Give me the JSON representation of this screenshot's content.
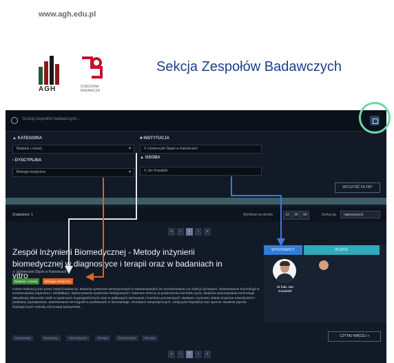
{
  "slide": {
    "url": "www.agh.edu.pl",
    "logo_text": "AGH",
    "dept_text": "DZIEDZINA BADAWCZA",
    "title": "Sekcja Zespołów Badawczych"
  },
  "app": {
    "search_placeholder": "Szukaj zespołów badawczych...",
    "filters": {
      "kategoria_label": "KATEGORIA",
      "kategoria_value": "Badania i rozwój",
      "dyscyplina_label": "DYSCYPLINA",
      "dyscyplina_value": "Biologia medyczna",
      "instytucja_label": "INSTYTUCJA",
      "instytucja_value": "Uniwersytet Śląski w Katowicach",
      "osoba_label": "OSOBA",
      "osoba_value": "Jan Kowalski",
      "clear_label": "WYCZYŚĆ FILTRY"
    },
    "results": {
      "count_label": "Znaleziono: 1",
      "per_page_label": "Wyników na stronie",
      "per_page_options": [
        "10",
        "20",
        "50"
      ],
      "sort_label": "Sortuj wg",
      "sort_value": "najnowszych"
    },
    "pager_top": [
      "«",
      "‹",
      "1",
      "›",
      "»"
    ],
    "pager_bottom": [
      "«",
      "‹",
      "1",
      "›",
      "»"
    ],
    "card": {
      "title": "Zespół Inżynierii Biomedycznej - Metody inżynierii biomedycznej w diagnostyce i terapii oraz w badaniach in vitro",
      "org": "Uniwersytet Śląski w Katowicach",
      "tags": [
        "Badania i rozwój",
        "Biologia medyczna"
      ],
      "description": "Celem realizacji prac przez zespół badawczy. Badania systemów sensorycznych w zastosowaniach do monitorowania czy funkcji życiowych. Zastosowanie technologii w monitorowaniu organizmu i rehabilitacji. Wykorzystanie systemów inteligentnych i Internetu Rzeczy w podnoszeniu komfortu życia. Badanie wykorzystania technologii aktualizacji obecności osób w systemach Kryptograficznych oraz w aplikacjach sterowania i komfortu pomiarowych. Badanie czynności układu krążenia metodą EEG i podstawy wywoływania. Zastosowanie termografii w podstawach w stomatologii, chorobach ortopedycznych, medycynie fizykalnej oraz sporcie. Badania płynów fizjologicznych metodą różnicowej kalorymetrii...",
      "keywords": [
        "Biomateriały",
        "Biosensory",
        "Telemedycyna",
        "Biologia",
        "Biomechanika",
        "Bio-data"
      ],
      "read_more": "CZYTAJ WIĘCEJ »"
    },
    "side": {
      "tab_left": "WYKONAWCY",
      "tab_right": "ZESPÓŁ",
      "person_name": "dr hab. Jan Kowalski"
    },
    "colors": {
      "orange_tag": "#e0641c",
      "green_tag": "#3b8a3a",
      "blue_tab": "#2f7fd9",
      "teal_tab": "#2eaaba",
      "ring": "#6fd6a8"
    }
  }
}
